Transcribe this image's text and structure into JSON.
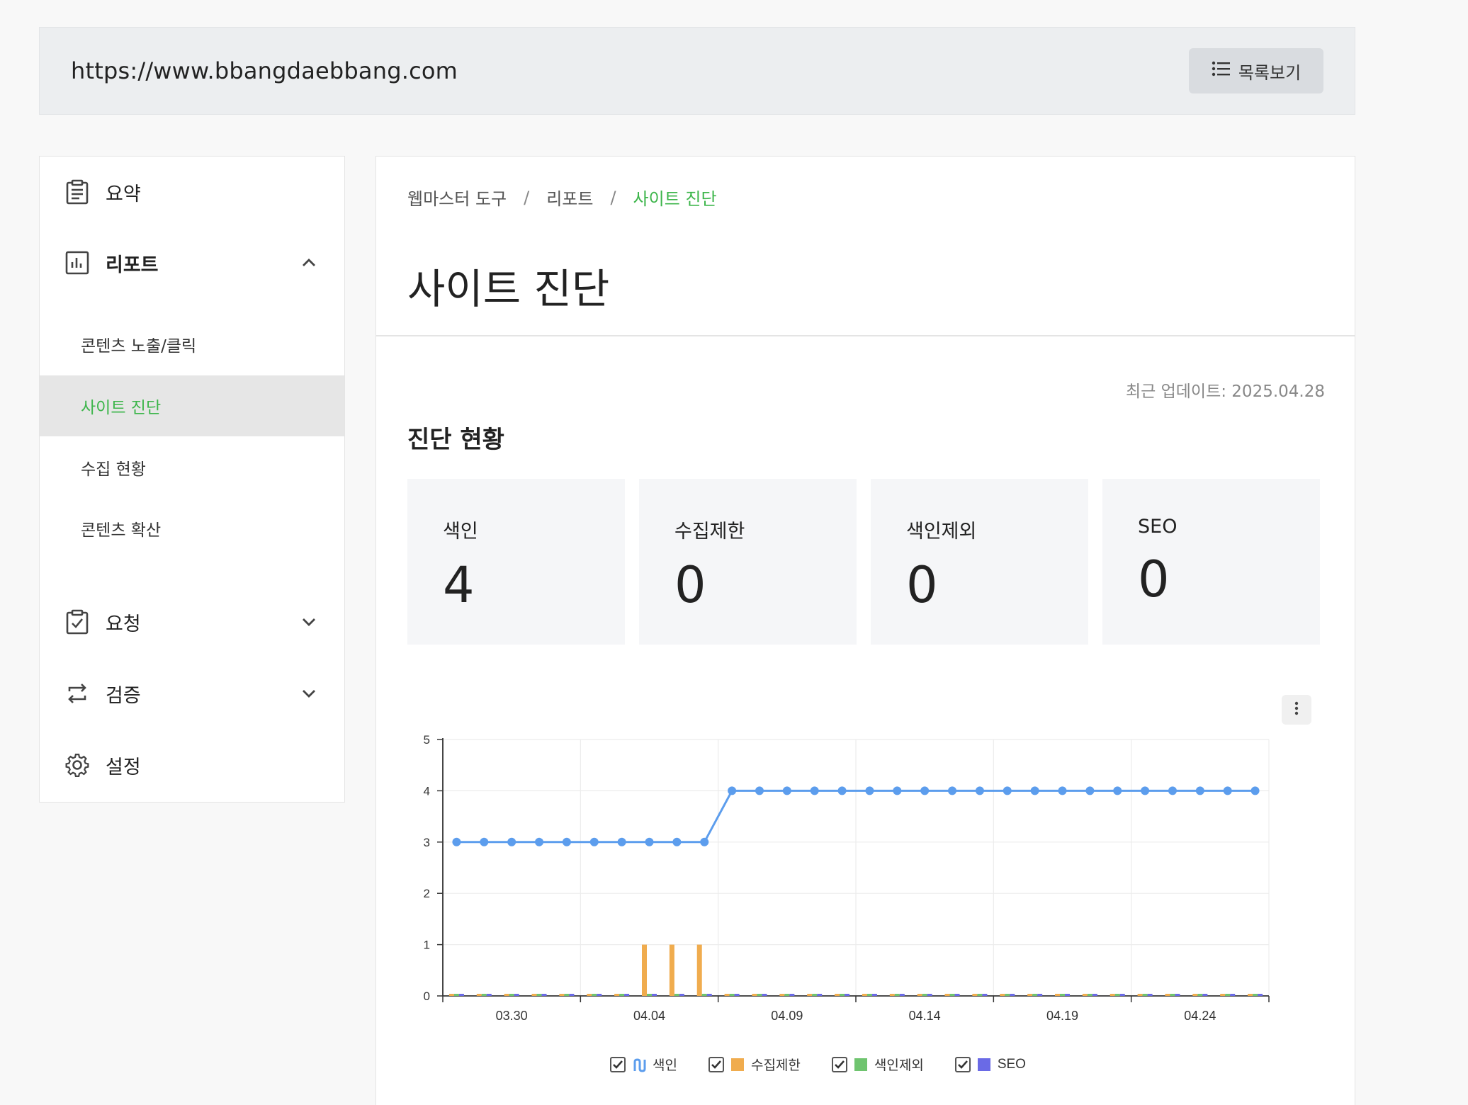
{
  "topbar": {
    "url": "https://www.bbangdaebbang.com",
    "list_button_label": "목록보기"
  },
  "sidebar": {
    "items": [
      {
        "label": "요약",
        "icon": "clipboard-icon"
      },
      {
        "label": "리포트",
        "icon": "chart-icon",
        "expanded": true
      },
      {
        "label": "요청",
        "icon": "checklist-icon",
        "expanded": false
      },
      {
        "label": "검증",
        "icon": "repeat-icon",
        "expanded": false
      },
      {
        "label": "설정",
        "icon": "gear-icon"
      }
    ],
    "report_sub": [
      {
        "label": "콘텐츠 노출/클릭",
        "active": false
      },
      {
        "label": "사이트 진단",
        "active": true
      },
      {
        "label": "수집 현황",
        "active": false
      },
      {
        "label": "콘텐츠 확산",
        "active": false
      }
    ]
  },
  "main": {
    "breadcrumbs": [
      "웹마스터 도구",
      "리포트",
      "사이트 진단"
    ],
    "page_title": "사이트 진단",
    "updated": "최근 업데이트: 2025.04.28",
    "section_title": "진단 현황",
    "cards": [
      {
        "label": "색인",
        "value": "4"
      },
      {
        "label": "수집제한",
        "value": "0"
      },
      {
        "label": "색인제외",
        "value": "0"
      },
      {
        "label": "SEO",
        "value": "0"
      }
    ]
  },
  "colors": {
    "accent": "#3cb54a",
    "index": "#5c9ded",
    "crawl_limit": "#f0ac4e",
    "excluded": "#6fc46f",
    "seo": "#6a6ae6"
  },
  "chart_data": {
    "type": "line",
    "x": [
      "03.28",
      "03.29",
      "03.30",
      "03.31",
      "04.01",
      "04.02",
      "04.03",
      "04.04",
      "04.05",
      "04.06",
      "04.07",
      "04.08",
      "04.09",
      "04.10",
      "04.11",
      "04.12",
      "04.13",
      "04.14",
      "04.15",
      "04.16",
      "04.17",
      "04.18",
      "04.19",
      "04.20",
      "04.21",
      "04.22",
      "04.23",
      "04.24",
      "04.25",
      "04.26"
    ],
    "tick_labels": [
      "03.30",
      "04.04",
      "04.09",
      "04.14",
      "04.19",
      "04.24"
    ],
    "ylim": [
      0,
      5
    ],
    "yticks": [
      0,
      1,
      2,
      3,
      4,
      5
    ],
    "series": [
      {
        "name": "색인",
        "kind": "line",
        "values": [
          3,
          3,
          3,
          3,
          3,
          3,
          3,
          3,
          3,
          3,
          4,
          4,
          4,
          4,
          4,
          4,
          4,
          4,
          4,
          4,
          4,
          4,
          4,
          4,
          4,
          4,
          4,
          4,
          4,
          4
        ]
      },
      {
        "name": "수집제한",
        "kind": "bar",
        "values": [
          0,
          0,
          0,
          0,
          0,
          0,
          0,
          1,
          1,
          1,
          0,
          0,
          0,
          0,
          0,
          0,
          0,
          0,
          0,
          0,
          0,
          0,
          0,
          0,
          0,
          0,
          0,
          0,
          0,
          0
        ]
      },
      {
        "name": "색인제외",
        "kind": "bar",
        "values": [
          0,
          0,
          0,
          0,
          0,
          0,
          0,
          0,
          0,
          0,
          0,
          0,
          0,
          0,
          0,
          0,
          0,
          0,
          0,
          0,
          0,
          0,
          0,
          0,
          0,
          0,
          0,
          0,
          0,
          0
        ]
      },
      {
        "name": "SEO",
        "kind": "bar",
        "values": [
          0,
          0,
          0,
          0,
          0,
          0,
          0,
          0,
          0,
          0,
          0,
          0,
          0,
          0,
          0,
          0,
          0,
          0,
          0,
          0,
          0,
          0,
          0,
          0,
          0,
          0,
          0,
          0,
          0,
          0
        ]
      }
    ],
    "grid": true,
    "legend_position": "bottom-center"
  }
}
